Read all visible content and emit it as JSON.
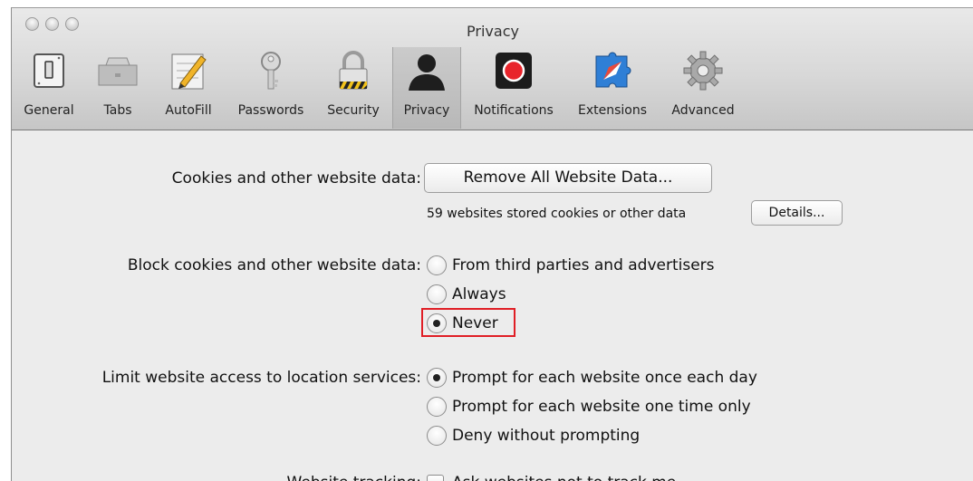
{
  "window": {
    "title": "Privacy"
  },
  "toolbar": {
    "items": [
      {
        "id": "general",
        "label": "General",
        "icon": "light-switch-icon"
      },
      {
        "id": "tabs",
        "label": "Tabs",
        "icon": "tabs-icon"
      },
      {
        "id": "autofill",
        "label": "AutoFill",
        "icon": "pencil-form-icon"
      },
      {
        "id": "passwords",
        "label": "Passwords",
        "icon": "key-icon"
      },
      {
        "id": "security",
        "label": "Security",
        "icon": "padlock-icon"
      },
      {
        "id": "privacy",
        "label": "Privacy",
        "icon": "person-silhouette-icon",
        "selected": true
      },
      {
        "id": "notifications",
        "label": "Notifications",
        "icon": "red-dot-icon"
      },
      {
        "id": "extensions",
        "label": "Extensions",
        "icon": "puzzle-compass-icon"
      },
      {
        "id": "advanced",
        "label": "Advanced",
        "icon": "gear-icon"
      }
    ]
  },
  "cookies": {
    "label": "Cookies and other website data:",
    "remove_button": "Remove All Website Data...",
    "stored_note": "59 websites stored cookies or other data",
    "details_button": "Details..."
  },
  "block": {
    "label": "Block cookies and other website data:",
    "options": [
      "From third parties and advertisers",
      "Always",
      "Never"
    ],
    "selected": "Never"
  },
  "location": {
    "label": "Limit website access to location services:",
    "options": [
      "Prompt for each website once each day",
      "Prompt for each website one time only",
      "Deny without prompting"
    ],
    "selected": "Prompt for each website once each day"
  },
  "tracking": {
    "label": "Website tracking:",
    "checkbox_label": "Ask websites not to track me",
    "checked": false
  },
  "colors": {
    "highlight": "#e01e25",
    "notification_red": "#e8242b"
  }
}
